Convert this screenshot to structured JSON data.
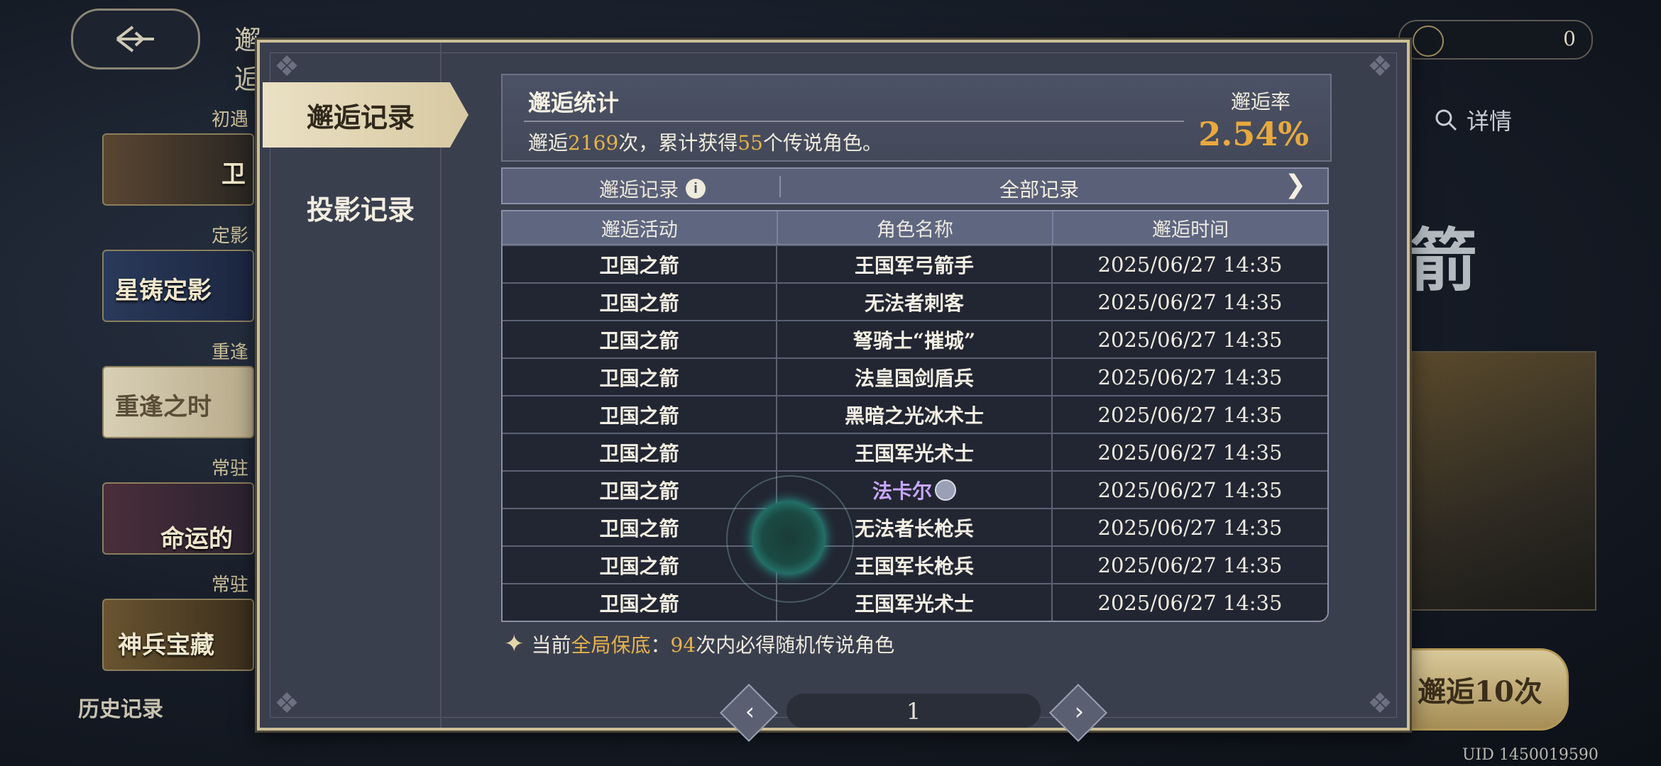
{
  "background": {
    "back_icon": "back-arrow-icon",
    "title_fragment": "邂逅",
    "currency_value": "0",
    "left_cards": [
      {
        "tag": "初遇",
        "label": "卫"
      },
      {
        "tag": "定影",
        "label": "星铸定影"
      },
      {
        "tag": "重逢",
        "label": "重逢之时"
      },
      {
        "tag": "常驻",
        "label": "命运的邂"
      },
      {
        "tag": "常驻",
        "label": "神兵宝藏"
      }
    ],
    "history_label": "历史记录",
    "detail_label": "详情",
    "right_glyph": "箭",
    "pull_ten_label": "邂逅10次",
    "uid": "UID 1450019590"
  },
  "modal": {
    "tabs": [
      {
        "label": "邂逅记录",
        "active": true
      },
      {
        "label": "投影记录",
        "active": false
      }
    ],
    "stats": {
      "title": "邂逅统计",
      "desc_prefix": "邂逅",
      "pull_count": "2169",
      "desc_mid": "次，累计获得",
      "legend_count": "55",
      "desc_suffix": "个传说角色。",
      "rate_label": "邂逅率",
      "rate_value": "2.54%"
    },
    "filter": {
      "label": "邂逅记录",
      "value": "全部记录"
    },
    "table": {
      "headers": [
        "邂逅活动",
        "角色名称",
        "邂逅时间"
      ],
      "rows": [
        {
          "event": "卫国之箭",
          "name": "王国军弓箭手",
          "time": "2025/06/27 14:35"
        },
        {
          "event": "卫国之箭",
          "name": "无法者刺客",
          "time": "2025/06/27 14:35"
        },
        {
          "event": "卫国之箭",
          "name": "弩骑士“摧城”",
          "time": "2025/06/27 14:35"
        },
        {
          "event": "卫国之箭",
          "name": "法皇国剑盾兵",
          "time": "2025/06/27 14:35"
        },
        {
          "event": "卫国之箭",
          "name": "黑暗之光冰术士",
          "time": "2025/06/27 14:35"
        },
        {
          "event": "卫国之箭",
          "name": "王国军光术士",
          "time": "2025/06/27 14:35"
        },
        {
          "event": "卫国之箭",
          "name": "法卡尔",
          "time": "2025/06/27 14:35",
          "legendary": true
        },
        {
          "event": "卫国之箭",
          "name": "无法者长枪兵",
          "time": "2025/06/27 14:35"
        },
        {
          "event": "卫国之箭",
          "name": "王国军长枪兵",
          "time": "2025/06/27 14:35"
        },
        {
          "event": "卫国之箭",
          "name": "王国军光术士",
          "time": "2025/06/27 14:35"
        }
      ]
    },
    "pity": {
      "prefix": "当前",
      "highlight": "全局保底",
      "colon": "：",
      "count": "94",
      "suffix": "次内必得随机传说角色"
    },
    "pager": {
      "page": "1"
    }
  },
  "colors": {
    "gold": "#e7b24a",
    "legend_purple": "#c7a7ff",
    "frame": "#cdbf96"
  }
}
